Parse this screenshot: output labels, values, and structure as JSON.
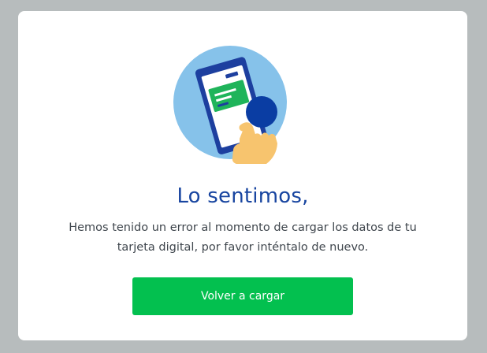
{
  "dialog": {
    "title": "Lo sentimos,",
    "message": "Hemos tenido un error al momento de cargar los datos de tu tarjeta digital, por favor inténtalo de nuevo.",
    "reload_button_label": "Volver a cargar",
    "illustration_icon": "phone-tap-error-illustration"
  },
  "colors": {
    "overlay": "#b7bcbd",
    "title": "#1845a0",
    "button": "#03c04f",
    "illustration_circle": "#86c2ea",
    "phone_frame": "#1d3f9f",
    "screen_card": "#1fb45a",
    "hand": "#f7c46e"
  }
}
